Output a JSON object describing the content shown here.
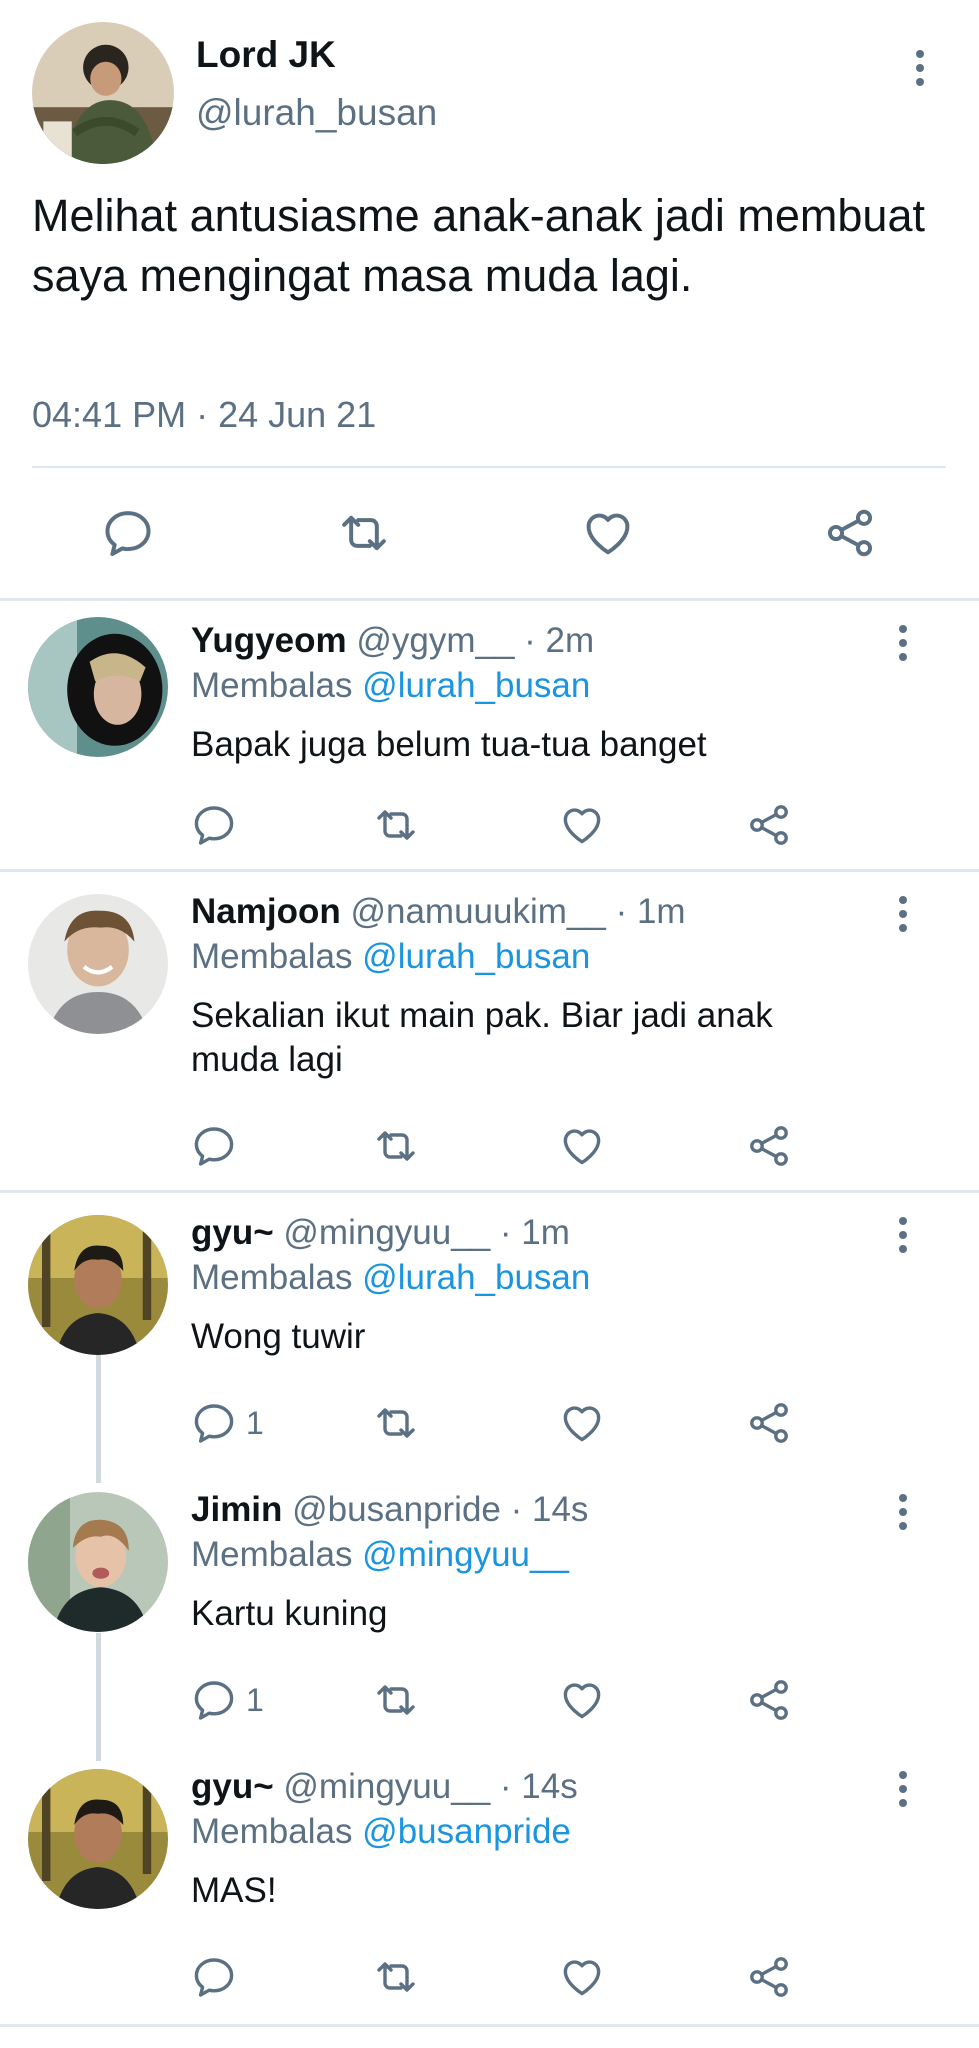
{
  "main": {
    "name": "Lord JK",
    "handle": "@lurah_busan",
    "text": "Melihat antusiasme anak-anak jadi membuat saya mengingat masa muda lagi.",
    "timestamp": "04:41 PM · 24 Jun 21"
  },
  "replies": [
    {
      "name": "Yugyeom",
      "handle": "@ygym__",
      "time": "· 2m",
      "replying_prefix": "Membalas ",
      "replying_to": "@lurah_busan",
      "text": "Bapak juga belum tua-tua banget",
      "reply_count": ""
    },
    {
      "name": "Namjoon",
      "handle": "@namuuukim__",
      "time": "· 1m",
      "replying_prefix": "Membalas ",
      "replying_to": "@lurah_busan",
      "text": "Sekalian ikut main pak. Biar jadi anak muda lagi",
      "reply_count": ""
    },
    {
      "name": "gyu~",
      "handle": "@mingyuu__",
      "time": "· 1m",
      "replying_prefix": "Membalas ",
      "replying_to": "@lurah_busan",
      "text": "Wong tuwir",
      "reply_count": "1"
    },
    {
      "name": "Jimin",
      "handle": "@busanpride",
      "time": "· 14s",
      "replying_prefix": "Membalas ",
      "replying_to": "@mingyuu__",
      "text": "Kartu kuning",
      "reply_count": "1"
    },
    {
      "name": "gyu~",
      "handle": "@mingyuu__",
      "time": "· 14s",
      "replying_prefix": "Membalas ",
      "replying_to": "@busanpride",
      "text": "MAS!",
      "reply_count": ""
    }
  ],
  "icons": {
    "reply": "reply-icon",
    "retweet": "retweet-icon",
    "like": "heart-icon",
    "share": "share-icon",
    "menu": "more-vertical-icon"
  },
  "colors": {
    "text": "#0f1419",
    "secondary": "#5b7083",
    "mention": "#1b95e0",
    "divider": "#e1e8ed"
  }
}
